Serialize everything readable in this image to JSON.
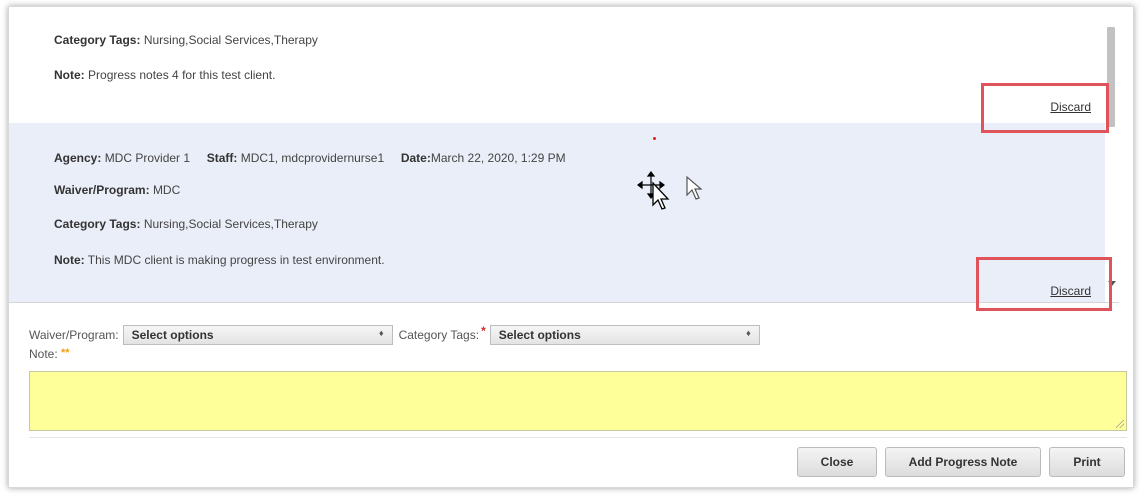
{
  "notes": [
    {
      "category_label": "Category Tags:",
      "category_value": "Nursing,Social Services,Therapy",
      "note_label": "Note:",
      "note_value": "Progress notes 4 for this test client.",
      "discard": "Discard"
    },
    {
      "agency_label": "Agency:",
      "agency_value": "MDC Provider 1",
      "staff_label": "Staff:",
      "staff_value": "MDC1, mdcprovidernurse1",
      "date_label": "Date:",
      "date_value": "March 22, 2020, 1:29 PM",
      "program_label": "Waiver/Program:",
      "program_value": "MDC",
      "category_label": "Category Tags:",
      "category_value": "Nursing,Social Services,Therapy",
      "note_label": "Note:",
      "note_value": "This MDC client is making progress in test environment.",
      "discard": "Discard"
    }
  ],
  "form": {
    "program_label": "Waiver/Program:",
    "program_select": "Select options",
    "category_label": "Category Tags:",
    "category_required": "*",
    "category_select": "Select options",
    "note_label": "Note:",
    "note_required": "**"
  },
  "buttons": {
    "close": "Close",
    "add": "Add Progress Note",
    "print": "Print"
  },
  "colors": {
    "highlight": "#e0535a",
    "note_area": "#ffff99",
    "selected_card": "#eaeef8"
  },
  "icons": [
    "move-cursor-icon",
    "pointer-cursor-icon",
    "scroll-down-icon",
    "select-arrow-icon",
    "resize-handle-icon"
  ]
}
